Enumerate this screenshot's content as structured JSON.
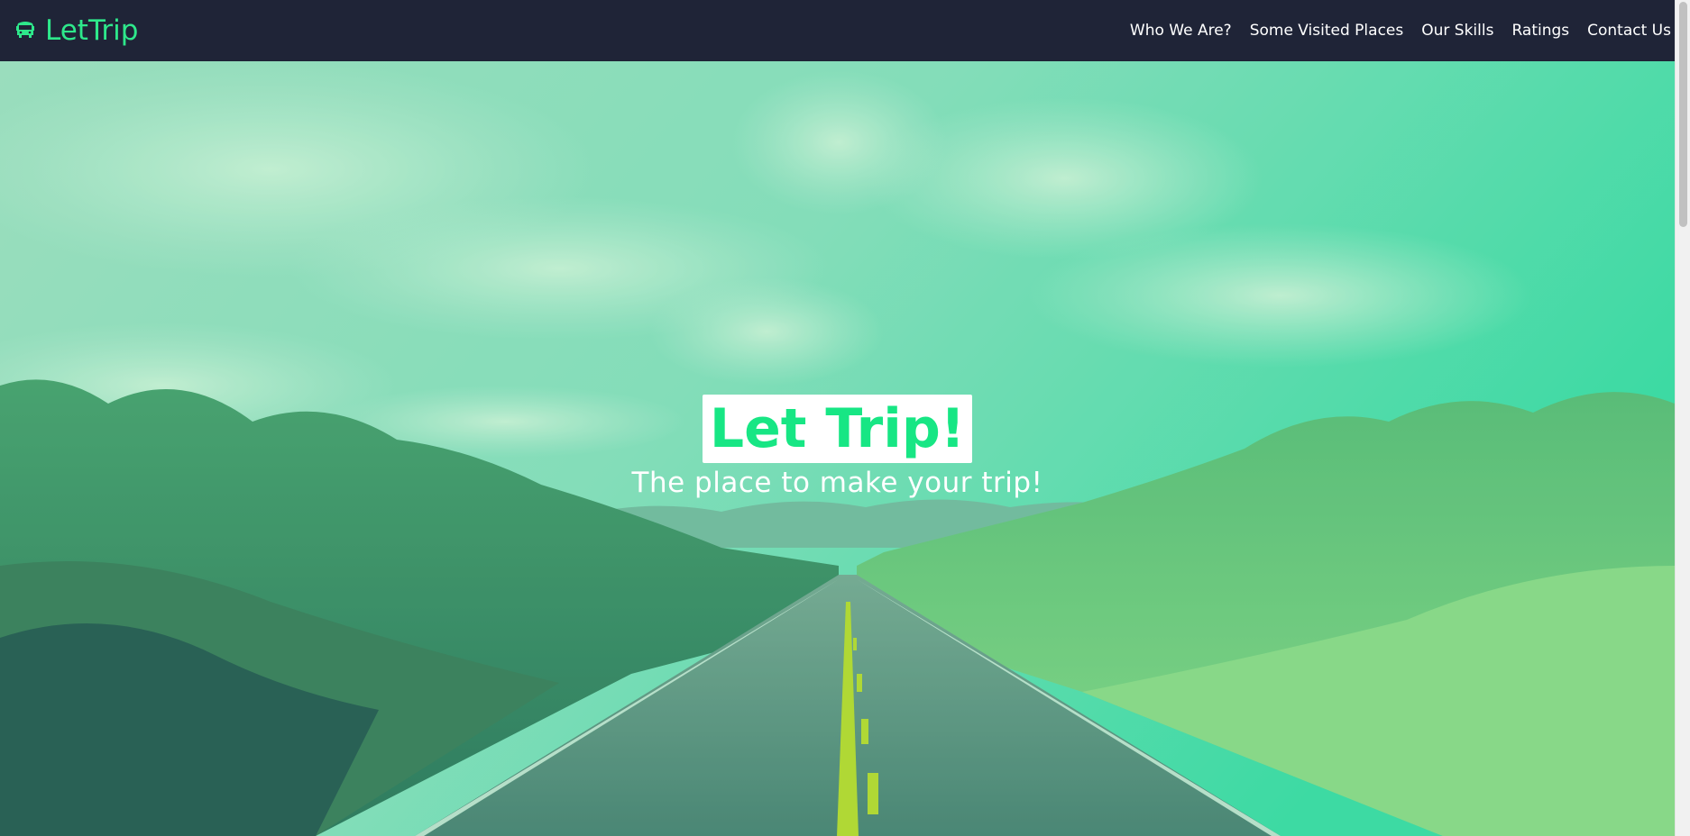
{
  "navbar": {
    "brand": "LetTrip",
    "brand_icon": "bus-icon",
    "links": [
      "Who We Are?",
      "Some Visited Places",
      "Our Skills",
      "Ratings",
      "Contact Us"
    ]
  },
  "hero": {
    "title": "Let Trip!",
    "subtitle": "The place to make your trip!"
  },
  "colors": {
    "accent": "#2ee88b",
    "title_text": "#17e684",
    "navbar_bg": "#1f2437"
  }
}
